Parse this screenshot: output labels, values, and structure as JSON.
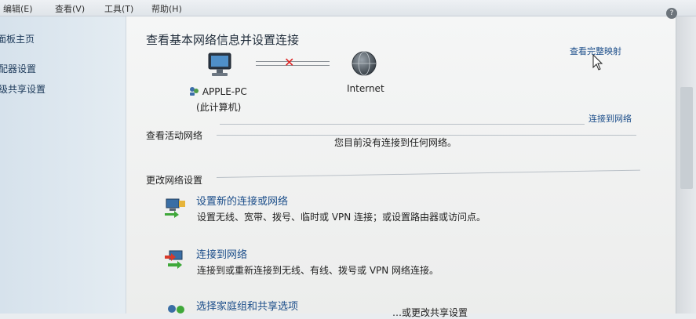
{
  "menu": {
    "edit": "编辑(E)",
    "view": "查看(V)",
    "tools": "工具(T)",
    "help": "帮助(H)"
  },
  "sidebar": {
    "items": [
      {
        "label": "面板主页"
      },
      {
        "label": "配器设置"
      },
      {
        "label": "级共享设置"
      }
    ]
  },
  "main": {
    "title": "查看基本网络信息并设置连接",
    "view_full_map": "查看完整映射",
    "computer_name": "APPLE-PC",
    "computer_sub": "(此计算机)",
    "internet_label": "Internet",
    "active_section": "查看活动网络",
    "connect_link": "连接到网络",
    "not_connected": "您目前没有连接到任何网络。",
    "change_section": "更改网络设置",
    "tasks": [
      {
        "link": "设置新的连接或网络",
        "desc": "设置无线、宽带、拨号、临时或 VPN 连接；或设置路由器或访问点。"
      },
      {
        "link": "连接到网络",
        "desc": "连接到或重新连接到无线、有线、拨号或 VPN 网络连接。"
      },
      {
        "link": "选择家庭组和共享选项",
        "desc": "…或更改共享设置"
      }
    ]
  },
  "colors": {
    "link": "#1c4e8a",
    "error_x": "#dd2222"
  }
}
